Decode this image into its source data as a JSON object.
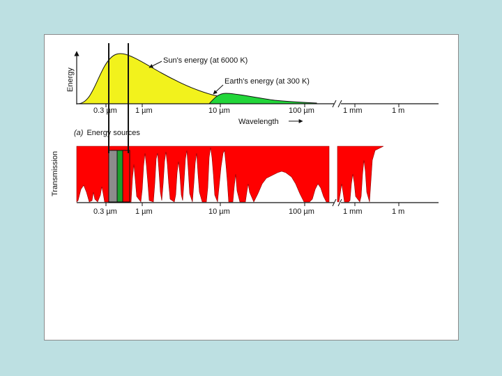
{
  "colors": {
    "background": "#bde0e2",
    "panel": "#ffffff",
    "sun_curve": "#f2f21c",
    "earth_curve": "#22d63a",
    "transmission": "#ff0000",
    "band_gray": "#8c8c8c",
    "band_green": "#1e9e2e"
  },
  "energy_panel": {
    "y_axis_label": "Energy",
    "x_axis_label": "Wavelength",
    "sun_label": "Sun's energy (at 6000 K)",
    "earth_label": "Earth's energy (at 300 K)",
    "caption_prefix": "(a)",
    "caption": "Energy sources"
  },
  "transmission_panel": {
    "y_axis_label": "Transmission"
  },
  "ticks": {
    "t1": "0.3 µm",
    "t2": "1 µm",
    "t3": "10 µm",
    "t4": "100 µm",
    "t5": "1 mm",
    "t6": "1 m"
  },
  "icons": {
    "axis_arrow": "arrow-icon",
    "axis_break": "axis-break-icon"
  }
}
